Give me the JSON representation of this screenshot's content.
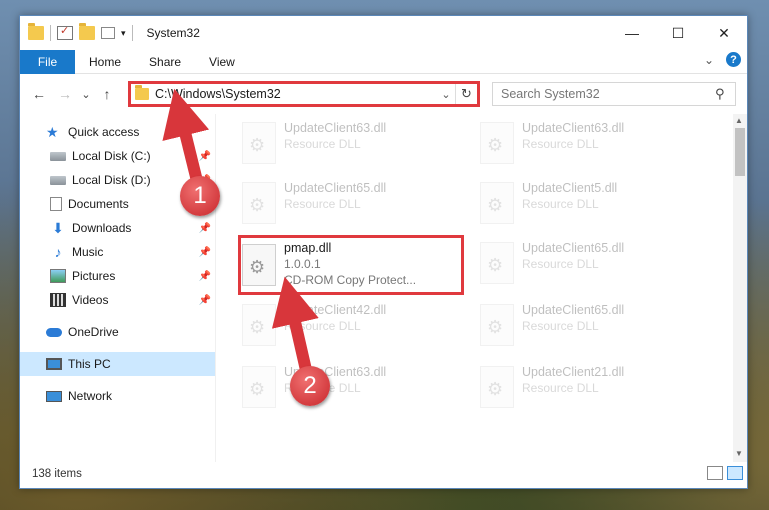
{
  "window": {
    "title": "System32",
    "minimize": "—",
    "maximize": "☐",
    "close": "✕"
  },
  "ribbon": {
    "file": "File",
    "tabs": [
      "Home",
      "Share",
      "View"
    ],
    "expand": "⌄",
    "help": "?"
  },
  "nav": {
    "back": "←",
    "forward": "→",
    "recent": "⌄",
    "up": "↑",
    "address": "C:\\Windows\\System32",
    "address_dropdown": "⌄",
    "refresh": "↻",
    "search_placeholder": "Search System32",
    "search_icon": "⚲"
  },
  "sidebar": {
    "items": [
      {
        "label": "Quick access",
        "icon": "star-icon"
      },
      {
        "label": "Local Disk (C:)",
        "icon": "drive-icon",
        "pinned": true
      },
      {
        "label": "Local Disk (D:)",
        "icon": "drive-icon",
        "pinned": true
      },
      {
        "label": "Documents",
        "icon": "documents-icon",
        "pinned": true
      },
      {
        "label": "Downloads",
        "icon": "downloads-icon",
        "pinned": true
      },
      {
        "label": "Music",
        "icon": "music-icon",
        "pinned": true
      },
      {
        "label": "Pictures",
        "icon": "pictures-icon",
        "pinned": true
      },
      {
        "label": "Videos",
        "icon": "videos-icon",
        "pinned": true
      },
      {
        "label": "OneDrive",
        "icon": "onedrive-icon"
      },
      {
        "label": "This PC",
        "icon": "pc-icon",
        "selected": true
      },
      {
        "label": "Network",
        "icon": "network-icon"
      }
    ],
    "pin_glyph": "📌"
  },
  "files": [
    {
      "name": "UpdateClient63.dll",
      "line2": "Resource DLL",
      "faded": true
    },
    {
      "name": "UpdateClient63.dll",
      "line2": "Resource DLL",
      "faded": true
    },
    {
      "name": "UpdateClient65.dll",
      "line2": "Resource DLL",
      "faded": true
    },
    {
      "name": "UpdateClient5.dll",
      "line2": "Resource DLL",
      "faded": true
    },
    {
      "name": "pmap.dll",
      "line2": "1.0.0.1",
      "line3": "CD-ROM Copy Protect...",
      "faded": false
    },
    {
      "name": "UpdateClient65.dll",
      "line2": "Resource DLL",
      "faded": true
    },
    {
      "name": "UpdateClient42.dll",
      "line2": "Resource DLL",
      "faded": true
    },
    {
      "name": "UpdateClient65.dll",
      "line2": "Resource DLL",
      "faded": true
    },
    {
      "name": "UpdateClient63.dll",
      "line2": "Resource DLL",
      "faded": true
    },
    {
      "name": "UpdateClient21.dll",
      "line2": "Resource DLL",
      "faded": true
    }
  ],
  "status": {
    "item_count": "138 items"
  },
  "annotations": {
    "step1": "1",
    "step2": "2",
    "color": "#e0393e"
  }
}
